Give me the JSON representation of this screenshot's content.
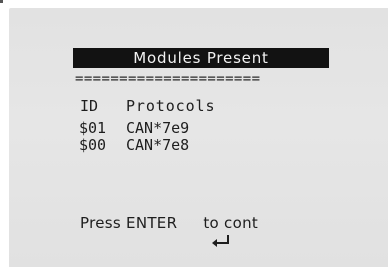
{
  "screen": {
    "title": "Modules Present",
    "separator": "=====================",
    "header": {
      "id_label": "ID",
      "protocols_label": "Protocols"
    },
    "modules": [
      {
        "id": "$01",
        "protocol": "CAN*7e9"
      },
      {
        "id": "$00",
        "protocol": "CAN*7e8"
      }
    ],
    "footer": {
      "prefix": "Press ENTER",
      "icon": "enter-icon",
      "suffix": "to cont"
    }
  }
}
